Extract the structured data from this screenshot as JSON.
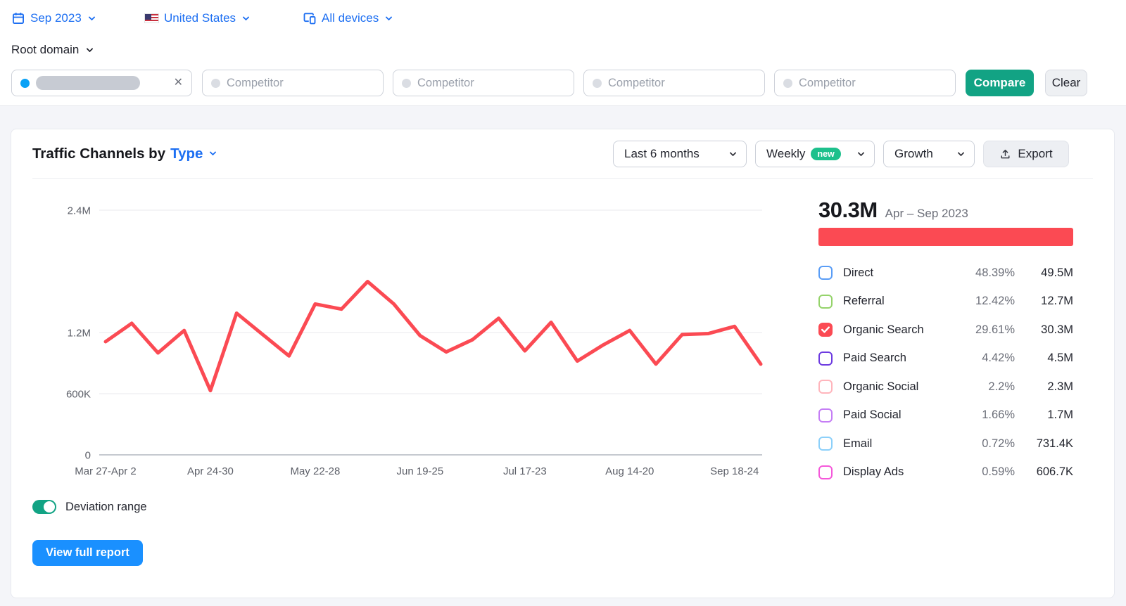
{
  "topbar": {
    "date_filter": {
      "icon": "calendar-icon",
      "label": "Sep 2023"
    },
    "location_filter": {
      "icon": "us-flag-icon",
      "label": "United States"
    },
    "device_filter": {
      "icon": "devices-icon",
      "label": "All devices"
    },
    "scope_selector": {
      "label": "Root domain"
    },
    "link_color": "#1d6ff2"
  },
  "compare_bar": {
    "main_domain_masked": true,
    "competitor_placeholder": "Competitor",
    "compare_button": "Compare",
    "clear_button": "Clear",
    "compare_color": "#12a384"
  },
  "report": {
    "title_prefix": "Traffic Channels by",
    "title_selector": "Type",
    "period_dropdown": "Last 6 months",
    "granularity_dropdown": "Weekly",
    "granularity_badge": "new",
    "metric_dropdown": "Growth",
    "export_button": "Export",
    "summary_total": "30.3M",
    "summary_range": "Apr – Sep 2023",
    "summary_bar_color": "#fb4a53",
    "legend": [
      {
        "label": "Direct",
        "percent": "48.39%",
        "value": "49.5M",
        "color": "#5a9df6",
        "checked": false
      },
      {
        "label": "Referral",
        "percent": "12.42%",
        "value": "12.7M",
        "color": "#95d36b",
        "checked": false
      },
      {
        "label": "Organic Search",
        "percent": "29.61%",
        "value": "30.3M",
        "color": "#fb4a53",
        "checked": true
      },
      {
        "label": "Paid Search",
        "percent": "4.42%",
        "value": "4.5M",
        "color": "#6d3be0",
        "checked": false
      },
      {
        "label": "Organic Social",
        "percent": "2.2%",
        "value": "2.3M",
        "color": "#ffb5bc",
        "checked": false
      },
      {
        "label": "Paid Social",
        "percent": "1.66%",
        "value": "1.7M",
        "color": "#c57ef5",
        "checked": false
      },
      {
        "label": "Email",
        "percent": "0.72%",
        "value": "731.4K",
        "color": "#8cd0fa",
        "checked": false
      },
      {
        "label": "Display Ads",
        "percent": "0.59%",
        "value": "606.7K",
        "color": "#f558da",
        "checked": false
      }
    ],
    "toggle_label": "Deviation range",
    "toggle_on": true,
    "cta_button": "View full report",
    "cta_color": "#1a90ff"
  },
  "chart_data": {
    "type": "line",
    "title": "Traffic Channels by Type",
    "unit": "visits (millions)",
    "grid": "horizontal",
    "legend_position": "right",
    "ylim": [
      0,
      2.6
    ],
    "y_ticks": [
      {
        "label": "0",
        "value": 0
      },
      {
        "label": "600K",
        "value": 0.6
      },
      {
        "label": "1.2M",
        "value": 1.2
      },
      {
        "label": "2.4M",
        "value": 2.4
      }
    ],
    "x_tick_labels": [
      "Mar 27-Apr 2",
      "Apr 24-30",
      "May 22-28",
      "Jun 19-25",
      "Jul 17-23",
      "Aug 14-20",
      "Sep 18-24"
    ],
    "x_tick_indices": [
      0,
      4,
      8,
      12,
      16,
      20,
      24
    ],
    "series": [
      {
        "name": "Organic Search",
        "color": "#fb4a53",
        "values": [
          1.11,
          1.29,
          1.0,
          1.22,
          0.63,
          1.39,
          1.18,
          0.97,
          1.48,
          1.43,
          1.7,
          1.48,
          1.17,
          1.01,
          1.13,
          1.34,
          1.02,
          1.3,
          0.92,
          1.08,
          1.22,
          0.89,
          1.18,
          1.19,
          1.26,
          0.89
        ]
      }
    ]
  }
}
